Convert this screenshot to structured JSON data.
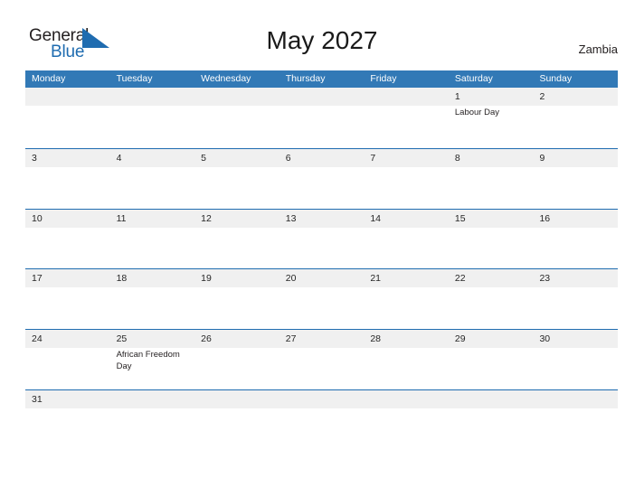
{
  "brand": {
    "name_part1": "General",
    "name_part2": "Blue",
    "mark": "triangle-logo-icon",
    "accent_color": "#1f6cb0"
  },
  "header": {
    "title": "May 2027",
    "country": "Zambia"
  },
  "theme": {
    "header_blue": "#3279b6",
    "rule_blue": "#1f6cb0",
    "band_gray": "#f0f0f0",
    "text_dark": "#262626"
  },
  "calendar": {
    "weekdays": [
      "Monday",
      "Tuesday",
      "Wednesday",
      "Thursday",
      "Friday",
      "Saturday",
      "Sunday"
    ],
    "weeks": [
      {
        "short": false,
        "days": [
          {
            "num": "",
            "event": ""
          },
          {
            "num": "",
            "event": ""
          },
          {
            "num": "",
            "event": ""
          },
          {
            "num": "",
            "event": ""
          },
          {
            "num": "",
            "event": ""
          },
          {
            "num": "1",
            "event": "Labour Day"
          },
          {
            "num": "2",
            "event": ""
          }
        ]
      },
      {
        "short": false,
        "days": [
          {
            "num": "3",
            "event": ""
          },
          {
            "num": "4",
            "event": ""
          },
          {
            "num": "5",
            "event": ""
          },
          {
            "num": "6",
            "event": ""
          },
          {
            "num": "7",
            "event": ""
          },
          {
            "num": "8",
            "event": ""
          },
          {
            "num": "9",
            "event": ""
          }
        ]
      },
      {
        "short": false,
        "days": [
          {
            "num": "10",
            "event": ""
          },
          {
            "num": "11",
            "event": ""
          },
          {
            "num": "12",
            "event": ""
          },
          {
            "num": "13",
            "event": ""
          },
          {
            "num": "14",
            "event": ""
          },
          {
            "num": "15",
            "event": ""
          },
          {
            "num": "16",
            "event": ""
          }
        ]
      },
      {
        "short": false,
        "days": [
          {
            "num": "17",
            "event": ""
          },
          {
            "num": "18",
            "event": ""
          },
          {
            "num": "19",
            "event": ""
          },
          {
            "num": "20",
            "event": ""
          },
          {
            "num": "21",
            "event": ""
          },
          {
            "num": "22",
            "event": ""
          },
          {
            "num": "23",
            "event": ""
          }
        ]
      },
      {
        "short": false,
        "days": [
          {
            "num": "24",
            "event": ""
          },
          {
            "num": "25",
            "event": "African Freedom Day"
          },
          {
            "num": "26",
            "event": ""
          },
          {
            "num": "27",
            "event": ""
          },
          {
            "num": "28",
            "event": ""
          },
          {
            "num": "29",
            "event": ""
          },
          {
            "num": "30",
            "event": ""
          }
        ]
      },
      {
        "short": true,
        "days": [
          {
            "num": "31",
            "event": ""
          },
          {
            "num": "",
            "event": ""
          },
          {
            "num": "",
            "event": ""
          },
          {
            "num": "",
            "event": ""
          },
          {
            "num": "",
            "event": ""
          },
          {
            "num": "",
            "event": ""
          },
          {
            "num": "",
            "event": ""
          }
        ]
      }
    ]
  }
}
